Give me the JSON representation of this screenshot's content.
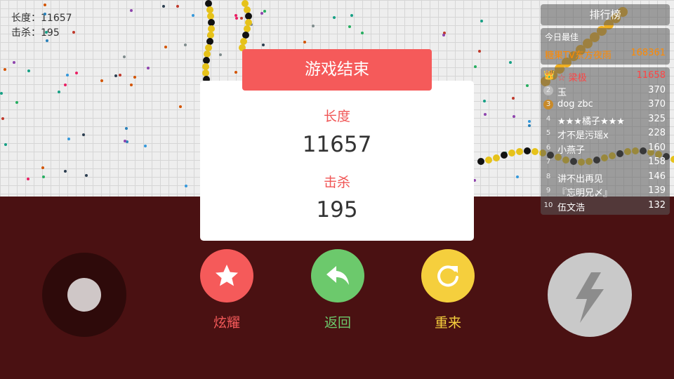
{
  "hud": {
    "length_text": "长度：11657",
    "kills_text": "击杀：195"
  },
  "leaderboard": {
    "title": "排行榜",
    "today_label": "今日最佳",
    "today_name": "糖果TV东方夜雨",
    "today_score": "168361",
    "rows": [
      {
        "rank": "👑",
        "name": "☆ 梁极",
        "score": "11658"
      },
      {
        "rank": "2",
        "name": "玉",
        "score": "370"
      },
      {
        "rank": "3",
        "name": "dog zbc",
        "score": "370"
      },
      {
        "rank": "4",
        "name": "★★★橘子★★★",
        "score": "325"
      },
      {
        "rank": "5",
        "name": "才不是污瑶x",
        "score": "228"
      },
      {
        "rank": "6",
        "name": "小燕子",
        "score": "160"
      },
      {
        "rank": "7",
        "name": "",
        "score": "158"
      },
      {
        "rank": "8",
        "name": "讲不出再见",
        "score": "146"
      },
      {
        "rank": "9",
        "name": "『忘明兄〆』",
        "score": "139"
      },
      {
        "rank": "10",
        "name": "伍文浩",
        "score": "132"
      }
    ]
  },
  "game_over": {
    "title": "游戏结束",
    "length_label": "长度",
    "length_value": "11657",
    "kills_label": "击杀",
    "kills_value": "195"
  },
  "buttons": {
    "share_label": "炫耀",
    "back_label": "返回",
    "restart_label": "重来",
    "share_color": "#f55a5a",
    "back_color": "#6cc96c",
    "restart_color": "#f5cf3d"
  },
  "icons": {
    "share": "star-icon",
    "back": "reply-arrow-icon",
    "restart": "refresh-icon",
    "boost": "lightning-icon"
  }
}
